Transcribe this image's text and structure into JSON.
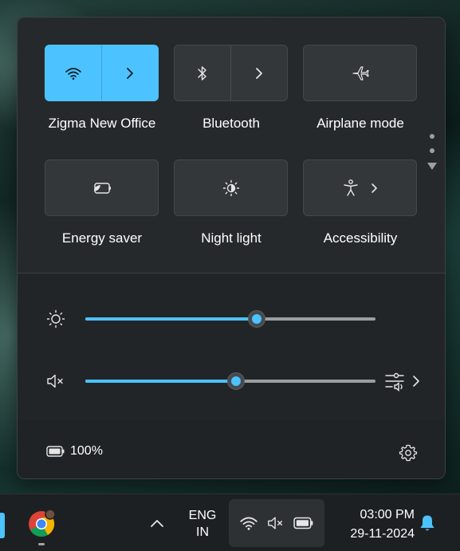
{
  "quick_settings": {
    "tiles": [
      {
        "label": "Zigma New Office",
        "icon": "wifi-icon",
        "active": true,
        "has_chevron": true
      },
      {
        "label": "Bluetooth",
        "icon": "bluetooth-icon",
        "active": false,
        "has_chevron": true
      },
      {
        "label": "Airplane mode",
        "icon": "airplane-icon",
        "active": false,
        "has_chevron": false
      },
      {
        "label": "Energy saver",
        "icon": "energy-saver-icon",
        "active": false,
        "has_chevron": false
      },
      {
        "label": "Night light",
        "icon": "night-light-icon",
        "active": false,
        "has_chevron": false
      },
      {
        "label": "Accessibility",
        "icon": "accessibility-icon",
        "active": false,
        "has_chevron": true
      }
    ],
    "brightness": {
      "icon": "brightness-icon",
      "value_percent": 59
    },
    "volume": {
      "icon": "volume-muted-icon",
      "value_percent": 52,
      "muted": true
    },
    "battery": {
      "icon": "battery-icon",
      "text": "100%"
    },
    "settings_icon": "gear-icon"
  },
  "taskbar": {
    "pinned_app_icon": "chrome-icon",
    "overflow_icon": "chevron-up-icon",
    "language": {
      "line1": "ENG",
      "line2": "IN"
    },
    "tray_icons": [
      "wifi-icon",
      "volume-muted-icon",
      "battery-icon"
    ],
    "time": "03:00 PM",
    "date": "29-11-2024",
    "notification_icon": "bell-icon"
  },
  "colors": {
    "accent": "#4cc2ff",
    "panel": "#272b2e",
    "taskbar": "#1d2022"
  }
}
